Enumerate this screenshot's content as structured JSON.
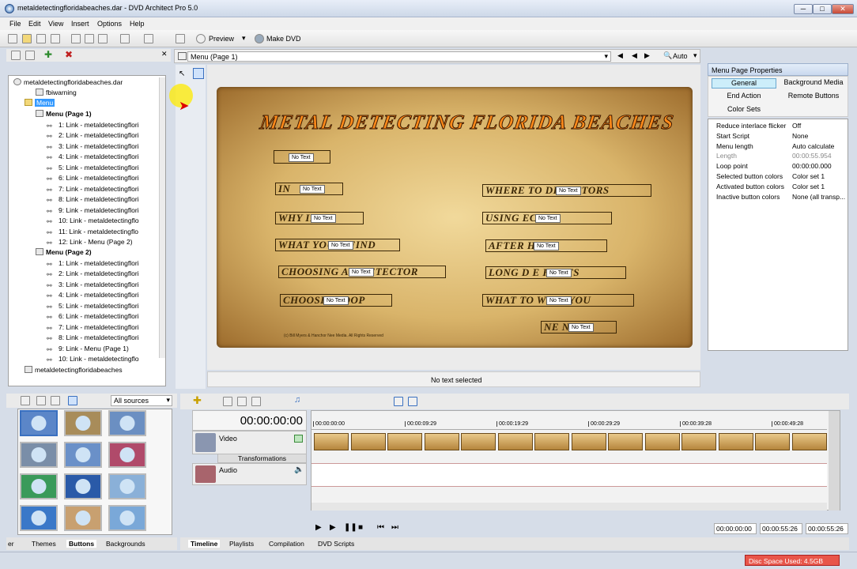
{
  "window": {
    "title": "metaldetectingfloridabeaches.dar - DVD Architect Pro 5.0",
    "minimize": "─",
    "maximize": "□",
    "close": "✕"
  },
  "menubar": [
    "File",
    "Edit",
    "View",
    "Insert",
    "Options",
    "Help"
  ],
  "toolbar": {
    "preview_label": "Preview",
    "make_dvd_label": "Make DVD"
  },
  "tree": {
    "root": "metaldetectingfloridabeaches.dar",
    "fbiwarning": "fbiwarning",
    "menu": "Menu",
    "page1": "Menu (Page 1)",
    "page1_links": [
      "1: Link - metaldetectingflori",
      "2: Link - metaldetectingflori",
      "3: Link - metaldetectingflori",
      "4: Link - metaldetectingflori",
      "5: Link - metaldetectingflori",
      "6: Link - metaldetectingflori",
      "7: Link - metaldetectingflori",
      "8: Link - metaldetectingflori",
      "9: Link - metaldetectingflori",
      "10: Link - metaldetectingflo",
      "11: Link - metaldetectingflo",
      "12: Link - Menu (Page 2)"
    ],
    "page2": "Menu (Page 2)",
    "page2_links": [
      "1: Link - metaldetectingflori",
      "2: Link - metaldetectingflori",
      "3: Link - metaldetectingflori",
      "4: Link - metaldetectingflori",
      "5: Link - metaldetectingflori",
      "6: Link - metaldetectingflori",
      "7: Link - metaldetectingflori",
      "8: Link - metaldetectingflori",
      "9: Link - Menu (Page 1)",
      "10: Link - metaldetectingflo"
    ],
    "footer": "metaldetectingfloridabeaches"
  },
  "editor": {
    "page_select": "Menu (Page 1)",
    "zoom": "Auto",
    "menu_title": "METAL DETECTING FLORIDA BEACHES",
    "no_text": "No Text",
    "left_items": [
      "IN",
      "WHY IDA?",
      "WHAT YOU N FIND",
      "CHOOSING A L DETECTOR",
      "CHOOSIN COOP"
    ],
    "right_items": [
      "WHERE TO DETECTORS",
      "USING ECTOR",
      "AFTER HUNT",
      "LONG D E HUNTS",
      "WHAT TO WITH YOU",
      "NE NU"
    ],
    "copyright": "(c) Bill Myers & Hanchor Nee Media. All Rights Reserved",
    "status": "No text selected"
  },
  "properties": {
    "title": "Menu Page Properties",
    "tabs": [
      "General",
      "Background Media",
      "End Action",
      "Remote Buttons",
      "Color Sets"
    ],
    "rows": [
      {
        "name": "Reduce interlace flicker",
        "value": "Off"
      },
      {
        "name": "Start Script",
        "value": "None"
      },
      {
        "name": "Menu length",
        "value": "Auto calculate"
      },
      {
        "name": "Length",
        "value": "00:00:55.954"
      },
      {
        "name": "Loop point",
        "value": "00:00:00.000"
      },
      {
        "name": "Selected button colors",
        "value": "Color set 1"
      },
      {
        "name": "Activated button colors",
        "value": "Color set 1"
      },
      {
        "name": "Inactive button colors",
        "value": "None (all transp..."
      }
    ]
  },
  "bottom_left": {
    "source_select": "All sources",
    "tabs": [
      "er",
      "Themes",
      "Buttons",
      "Backgrounds"
    ]
  },
  "timeline": {
    "timecode": "00:00:00:00",
    "ruler": [
      "00:00:00:00",
      "00:00:09:29",
      "00:00:19:29",
      "00:00:29:29",
      "00:00:39:28",
      "00:00:49:28"
    ],
    "tracks": {
      "video": "Video",
      "transformations": "Transformations",
      "audio": "Audio"
    },
    "readouts": [
      "00:00:00:00",
      "00:00:55:26",
      "00:00:55:26"
    ],
    "tabs": [
      "Timeline",
      "Playlists",
      "Compilation",
      "DVD Scripts"
    ]
  },
  "status": {
    "disc_space": "Disc Space Used: 4.5GB"
  },
  "colors": {
    "accent": "#3399ff",
    "disc_bar": "#e8554a",
    "parchment": "#d9b46a",
    "title_fill": "#ff8a1a"
  }
}
